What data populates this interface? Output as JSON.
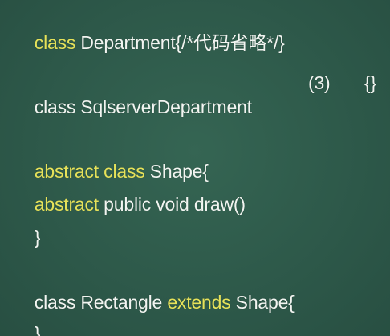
{
  "colors": {
    "background": "#2f5b4b",
    "keyword": "#e6e25a",
    "text": "#f2f5f1"
  },
  "code": {
    "line1": {
      "kw": "class",
      "text": " Department{/*代码省略*/}"
    },
    "line2": {
      "name": "class SqlserverDepartment",
      "marker": "(3)",
      "braces": "{}"
    },
    "line3": {
      "kw": "abstract class",
      "text": " Shape{"
    },
    "line4": {
      "kw": "abstract",
      "text": " public void draw()"
    },
    "line5": {
      "text": "}"
    },
    "line6": {
      "text1": "class Rectangle ",
      "kw": "extends",
      "text2": " Shape{"
    },
    "line7": {
      "text": "}"
    }
  }
}
